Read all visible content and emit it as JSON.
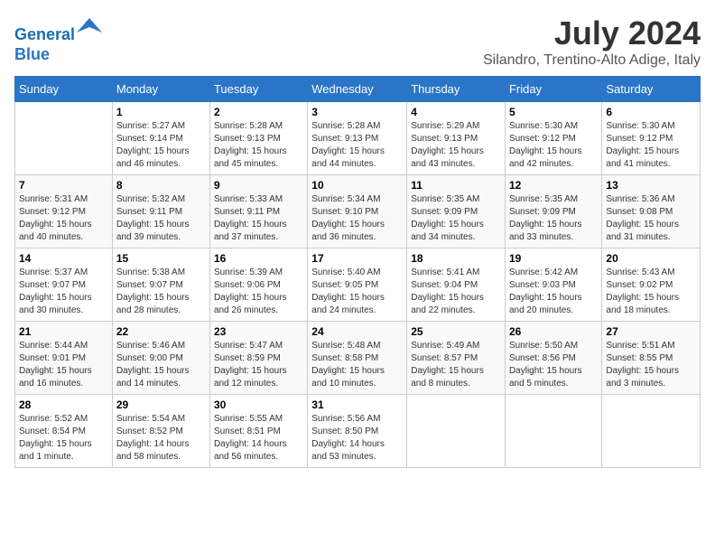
{
  "logo": {
    "line1": "General",
    "line2": "Blue"
  },
  "title": "July 2024",
  "subtitle": "Silandro, Trentino-Alto Adige, Italy",
  "header": {
    "days": [
      "Sunday",
      "Monday",
      "Tuesday",
      "Wednesday",
      "Thursday",
      "Friday",
      "Saturday"
    ]
  },
  "weeks": [
    [
      {
        "day": "",
        "info": ""
      },
      {
        "day": "1",
        "info": "Sunrise: 5:27 AM\nSunset: 9:14 PM\nDaylight: 15 hours\nand 46 minutes."
      },
      {
        "day": "2",
        "info": "Sunrise: 5:28 AM\nSunset: 9:13 PM\nDaylight: 15 hours\nand 45 minutes."
      },
      {
        "day": "3",
        "info": "Sunrise: 5:28 AM\nSunset: 9:13 PM\nDaylight: 15 hours\nand 44 minutes."
      },
      {
        "day": "4",
        "info": "Sunrise: 5:29 AM\nSunset: 9:13 PM\nDaylight: 15 hours\nand 43 minutes."
      },
      {
        "day": "5",
        "info": "Sunrise: 5:30 AM\nSunset: 9:12 PM\nDaylight: 15 hours\nand 42 minutes."
      },
      {
        "day": "6",
        "info": "Sunrise: 5:30 AM\nSunset: 9:12 PM\nDaylight: 15 hours\nand 41 minutes."
      }
    ],
    [
      {
        "day": "7",
        "info": "Sunrise: 5:31 AM\nSunset: 9:12 PM\nDaylight: 15 hours\nand 40 minutes."
      },
      {
        "day": "8",
        "info": "Sunrise: 5:32 AM\nSunset: 9:11 PM\nDaylight: 15 hours\nand 39 minutes."
      },
      {
        "day": "9",
        "info": "Sunrise: 5:33 AM\nSunset: 9:11 PM\nDaylight: 15 hours\nand 37 minutes."
      },
      {
        "day": "10",
        "info": "Sunrise: 5:34 AM\nSunset: 9:10 PM\nDaylight: 15 hours\nand 36 minutes."
      },
      {
        "day": "11",
        "info": "Sunrise: 5:35 AM\nSunset: 9:09 PM\nDaylight: 15 hours\nand 34 minutes."
      },
      {
        "day": "12",
        "info": "Sunrise: 5:35 AM\nSunset: 9:09 PM\nDaylight: 15 hours\nand 33 minutes."
      },
      {
        "day": "13",
        "info": "Sunrise: 5:36 AM\nSunset: 9:08 PM\nDaylight: 15 hours\nand 31 minutes."
      }
    ],
    [
      {
        "day": "14",
        "info": "Sunrise: 5:37 AM\nSunset: 9:07 PM\nDaylight: 15 hours\nand 30 minutes."
      },
      {
        "day": "15",
        "info": "Sunrise: 5:38 AM\nSunset: 9:07 PM\nDaylight: 15 hours\nand 28 minutes."
      },
      {
        "day": "16",
        "info": "Sunrise: 5:39 AM\nSunset: 9:06 PM\nDaylight: 15 hours\nand 26 minutes."
      },
      {
        "day": "17",
        "info": "Sunrise: 5:40 AM\nSunset: 9:05 PM\nDaylight: 15 hours\nand 24 minutes."
      },
      {
        "day": "18",
        "info": "Sunrise: 5:41 AM\nSunset: 9:04 PM\nDaylight: 15 hours\nand 22 minutes."
      },
      {
        "day": "19",
        "info": "Sunrise: 5:42 AM\nSunset: 9:03 PM\nDaylight: 15 hours\nand 20 minutes."
      },
      {
        "day": "20",
        "info": "Sunrise: 5:43 AM\nSunset: 9:02 PM\nDaylight: 15 hours\nand 18 minutes."
      }
    ],
    [
      {
        "day": "21",
        "info": "Sunrise: 5:44 AM\nSunset: 9:01 PM\nDaylight: 15 hours\nand 16 minutes."
      },
      {
        "day": "22",
        "info": "Sunrise: 5:46 AM\nSunset: 9:00 PM\nDaylight: 15 hours\nand 14 minutes."
      },
      {
        "day": "23",
        "info": "Sunrise: 5:47 AM\nSunset: 8:59 PM\nDaylight: 15 hours\nand 12 minutes."
      },
      {
        "day": "24",
        "info": "Sunrise: 5:48 AM\nSunset: 8:58 PM\nDaylight: 15 hours\nand 10 minutes."
      },
      {
        "day": "25",
        "info": "Sunrise: 5:49 AM\nSunset: 8:57 PM\nDaylight: 15 hours\nand 8 minutes."
      },
      {
        "day": "26",
        "info": "Sunrise: 5:50 AM\nSunset: 8:56 PM\nDaylight: 15 hours\nand 5 minutes."
      },
      {
        "day": "27",
        "info": "Sunrise: 5:51 AM\nSunset: 8:55 PM\nDaylight: 15 hours\nand 3 minutes."
      }
    ],
    [
      {
        "day": "28",
        "info": "Sunrise: 5:52 AM\nSunset: 8:54 PM\nDaylight: 15 hours\nand 1 minute."
      },
      {
        "day": "29",
        "info": "Sunrise: 5:54 AM\nSunset: 8:52 PM\nDaylight: 14 hours\nand 58 minutes."
      },
      {
        "day": "30",
        "info": "Sunrise: 5:55 AM\nSunset: 8:51 PM\nDaylight: 14 hours\nand 56 minutes."
      },
      {
        "day": "31",
        "info": "Sunrise: 5:56 AM\nSunset: 8:50 PM\nDaylight: 14 hours\nand 53 minutes."
      },
      {
        "day": "",
        "info": ""
      },
      {
        "day": "",
        "info": ""
      },
      {
        "day": "",
        "info": ""
      }
    ]
  ]
}
